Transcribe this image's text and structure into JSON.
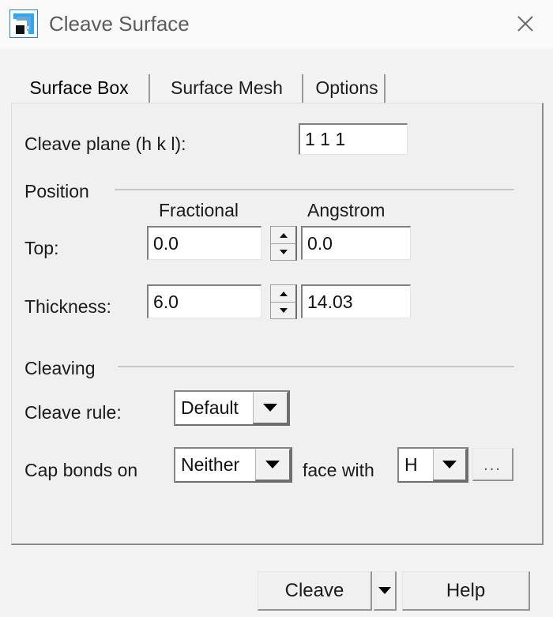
{
  "window": {
    "title": "Cleave Surface",
    "icon": "app-cleave-surface-icon",
    "close_label": "×"
  },
  "tabs": [
    {
      "label": "Surface Box",
      "active": true
    },
    {
      "label": "Surface Mesh",
      "active": false
    },
    {
      "label": "Options",
      "active": false
    }
  ],
  "form": {
    "cleave_plane": {
      "label": "Cleave plane (h k l):",
      "value": "1 1 1"
    },
    "position_group": {
      "title": "Position",
      "col_fractional": "Fractional",
      "col_angstrom": "Angstrom",
      "rows": [
        {
          "label": "Top:",
          "fractional": "0.0",
          "angstrom": "0.0"
        },
        {
          "label": "Thickness:",
          "fractional": "6.0",
          "angstrom": "14.03"
        }
      ]
    },
    "cleaving_group": {
      "title": "Cleaving",
      "cleave_rule": {
        "label": "Cleave rule:",
        "value": "Default"
      },
      "cap_bonds": {
        "label": "Cap bonds on",
        "side_value": "Neither",
        "mid_label": "face with",
        "element_value": "H",
        "browse_label": "..."
      }
    }
  },
  "footer": {
    "cleave_label": "Cleave",
    "cleave_more_icon": "chevron-down-icon",
    "help_label": "Help"
  },
  "colors": {
    "window_bg": "#f3f3f3",
    "panel_bg": "#f0f0f0",
    "title_text": "#5c5c5c",
    "text": "#1b1b1b",
    "icon_blue": "#1e9cf0",
    "separator": "#c8c8c8"
  }
}
